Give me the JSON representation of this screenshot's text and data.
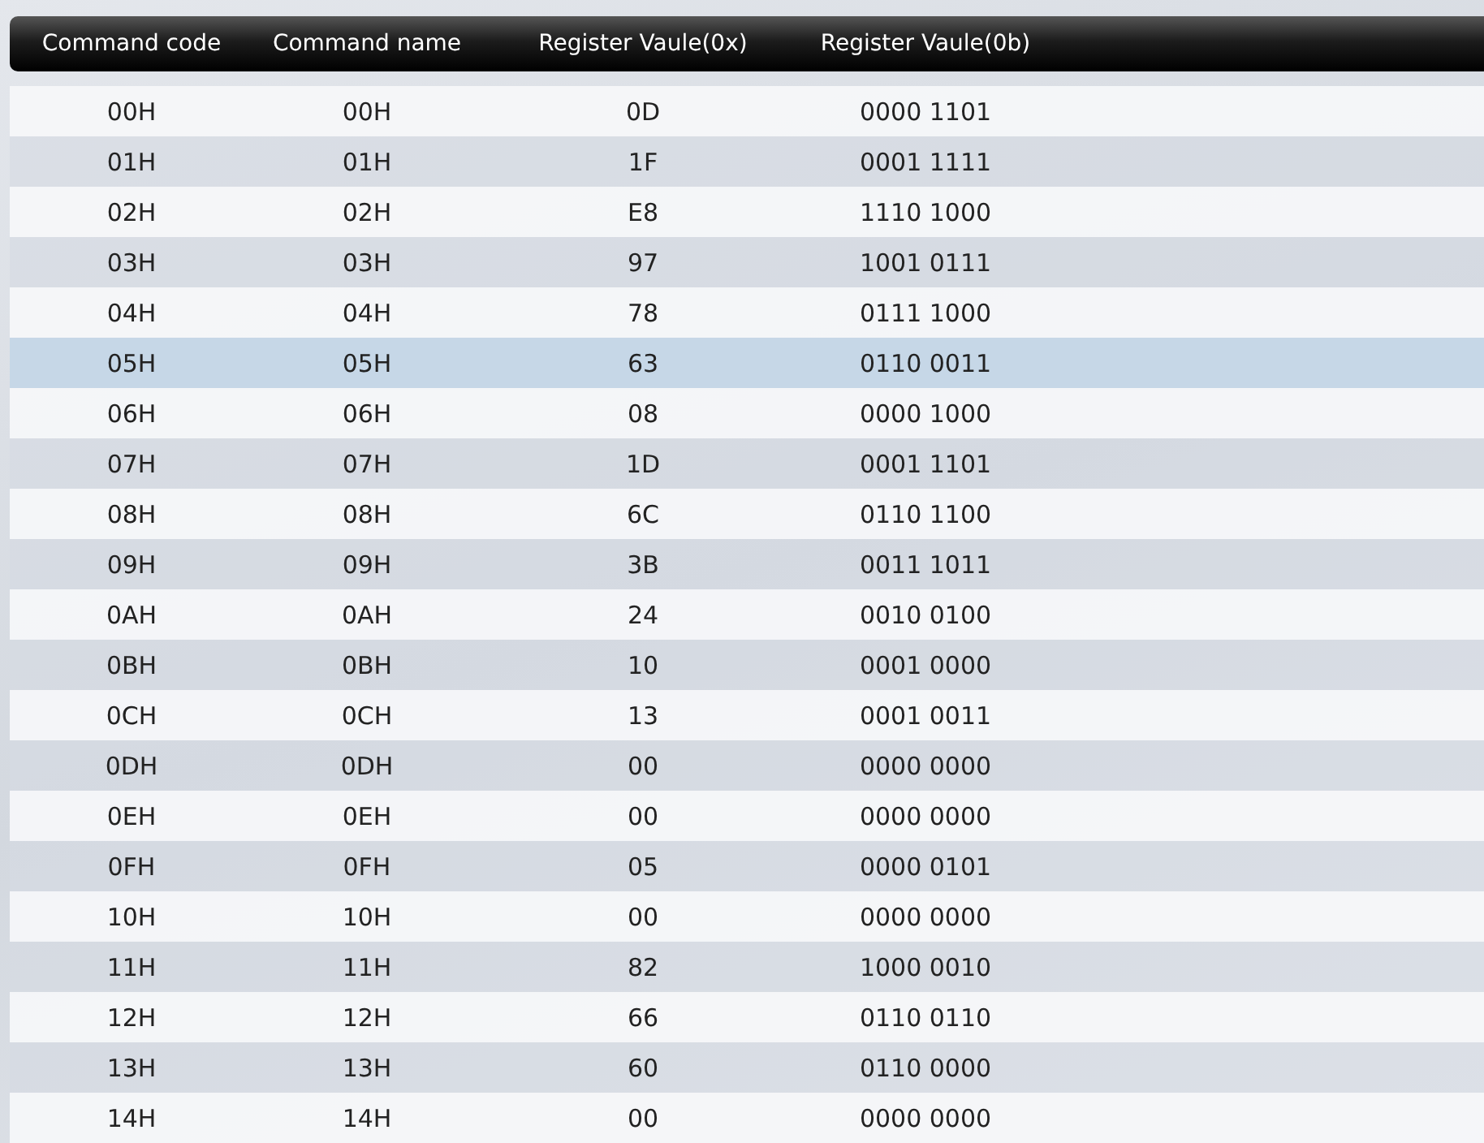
{
  "table": {
    "columns": [
      "Command code",
      "Command name",
      "Register Vaule(0x)",
      "Register Vaule(0b)"
    ],
    "rows": [
      {
        "cells": [
          "00H",
          "00H",
          "0D",
          "0000 1101"
        ],
        "selected": false
      },
      {
        "cells": [
          "01H",
          "01H",
          "1F",
          "0001 1111"
        ],
        "selected": false
      },
      {
        "cells": [
          "02H",
          "02H",
          "E8",
          "1110 1000"
        ],
        "selected": false
      },
      {
        "cells": [
          "03H",
          "03H",
          "97",
          "1001 0111"
        ],
        "selected": false
      },
      {
        "cells": [
          "04H",
          "04H",
          "78",
          "0111 1000"
        ],
        "selected": false
      },
      {
        "cells": [
          "05H",
          "05H",
          "63",
          "0110 0011"
        ],
        "selected": true
      },
      {
        "cells": [
          "06H",
          "06H",
          "08",
          "0000 1000"
        ],
        "selected": false
      },
      {
        "cells": [
          "07H",
          "07H",
          "1D",
          "0001 1101"
        ],
        "selected": false
      },
      {
        "cells": [
          "08H",
          "08H",
          "6C",
          "0110 1100"
        ],
        "selected": false
      },
      {
        "cells": [
          "09H",
          "09H",
          "3B",
          "0011 1011"
        ],
        "selected": false
      },
      {
        "cells": [
          "0AH",
          "0AH",
          "24",
          "0010 0100"
        ],
        "selected": false
      },
      {
        "cells": [
          "0BH",
          "0BH",
          "10",
          "0001 0000"
        ],
        "selected": false
      },
      {
        "cells": [
          "0CH",
          "0CH",
          "13",
          "0001 0011"
        ],
        "selected": false
      },
      {
        "cells": [
          "0DH",
          "0DH",
          "00",
          "0000 0000"
        ],
        "selected": false
      },
      {
        "cells": [
          "0EH",
          "0EH",
          "00",
          "0000 0000"
        ],
        "selected": false
      },
      {
        "cells": [
          "0FH",
          "0FH",
          "05",
          "0000 0101"
        ],
        "selected": false
      },
      {
        "cells": [
          "10H",
          "10H",
          "00",
          "0000 0000"
        ],
        "selected": false
      },
      {
        "cells": [
          "11H",
          "11H",
          "82",
          "1000 0010"
        ],
        "selected": false
      },
      {
        "cells": [
          "12H",
          "12H",
          "66",
          "0110 0110"
        ],
        "selected": false
      },
      {
        "cells": [
          "13H",
          "13H",
          "60",
          "0110 0000"
        ],
        "selected": false
      },
      {
        "cells": [
          "14H",
          "14H",
          "00",
          "0000 0000"
        ],
        "selected": false
      }
    ]
  }
}
